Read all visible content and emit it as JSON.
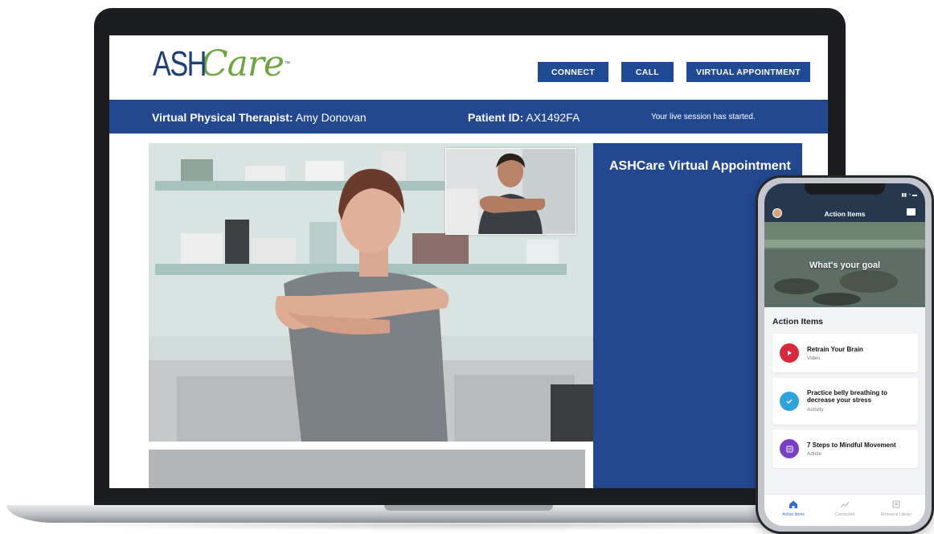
{
  "brand": {
    "logo_ash": "ASH",
    "logo_care": "Care",
    "logo_tm": "™"
  },
  "nav": {
    "connect_label": "CONNECT",
    "call_label": "CALL",
    "virtual_appointment_label": "VIRTUAL APPOINTMENT"
  },
  "info_bar": {
    "therapist_label": "Virtual Physical Therapist:",
    "therapist_name": "Amy Donovan",
    "patient_label": "Patient ID:",
    "patient_id": "AX1492FA",
    "session_status": "Your live session has started."
  },
  "side_panel": {
    "title": "ASHCare Virtual Appointment"
  },
  "phone": {
    "header_title": "Action Items",
    "hero_text": "What's your goal",
    "section_title": "Action Items",
    "items": [
      {
        "title": "Retrain Your Brain",
        "type": "Video",
        "icon": "play-icon",
        "color": "#d62b3d"
      },
      {
        "title": "Practice belly breathing to decrease your stress",
        "type": "Activity",
        "icon": "check-icon",
        "color": "#2fa4d9"
      },
      {
        "title": "7 Steps to Mindful Movement",
        "type": "Article",
        "icon": "article-icon",
        "color": "#7b3fc4"
      }
    ],
    "tabs": [
      {
        "label": "Action Items",
        "icon": "home-icon",
        "active": true
      },
      {
        "label": "Connected",
        "icon": "trend-icon",
        "active": false
      },
      {
        "label": "Resource Library",
        "icon": "library-icon",
        "active": false
      }
    ]
  },
  "colors": {
    "brand_blue": "#23488f",
    "brand_green": "#6ea542",
    "button_blue": "#204a93"
  }
}
